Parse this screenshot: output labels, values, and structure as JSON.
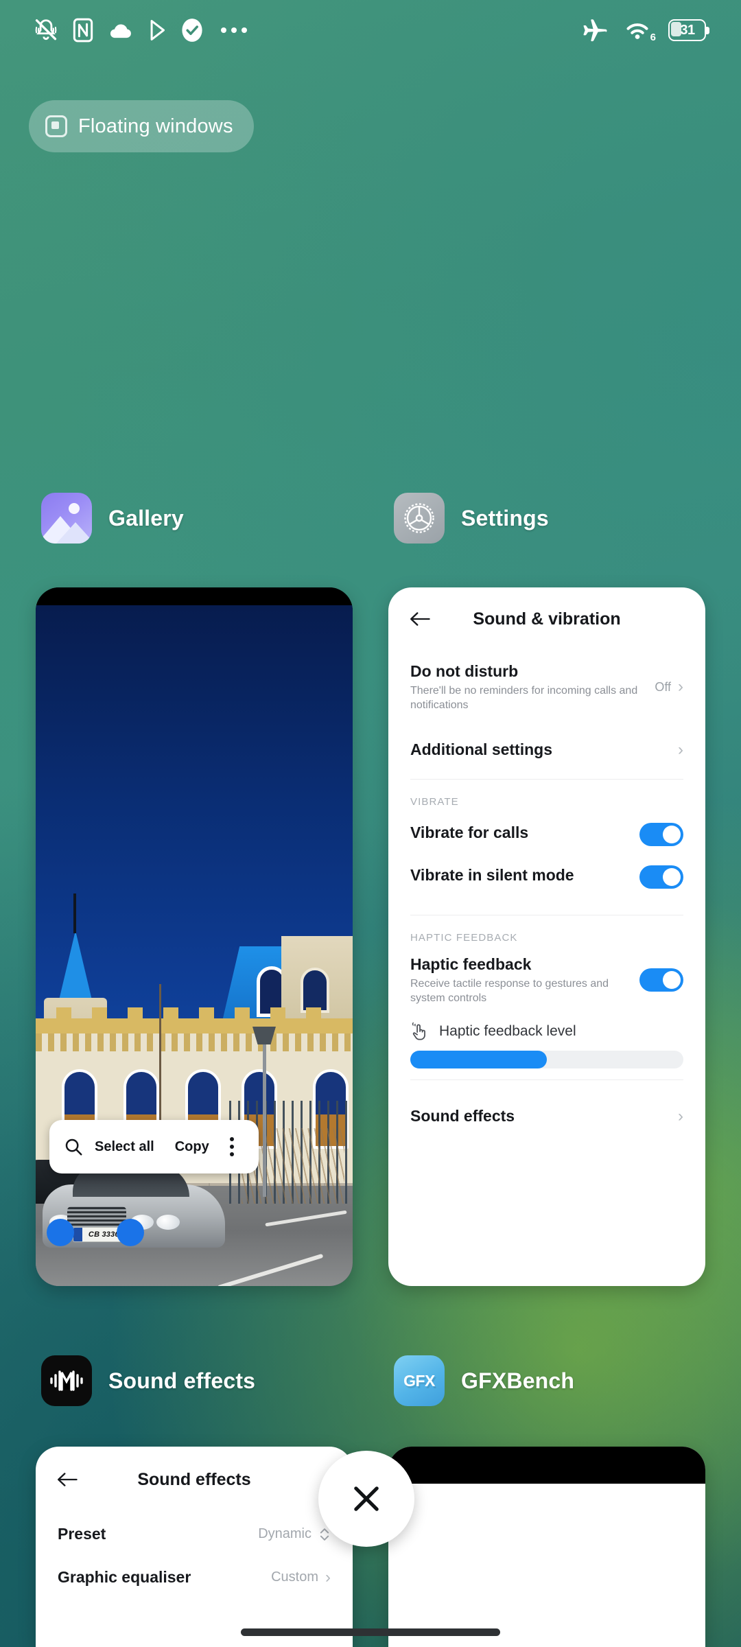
{
  "status_bar": {
    "left_icons": [
      "silent-bell-icon",
      "nfc-icon",
      "cloud-icon",
      "play-store-icon",
      "check-circle-icon",
      "more-icon"
    ],
    "right_icons": [
      "airplane-mode-icon",
      "wifi-6-icon"
    ],
    "wifi_generation": "6",
    "battery_percent": "31"
  },
  "floating_windows_pill": {
    "label": "Floating windows",
    "icon": "floating-window-icon"
  },
  "recents": [
    {
      "app_name": "Gallery",
      "icon": "gallery-icon",
      "selection_toolbar": {
        "search_icon": "search-icon",
        "select_all": "Select all",
        "copy": "Copy",
        "overflow_icon": "kebab-menu-icon"
      },
      "photo": {
        "license_plate": "CB 3336 HT"
      }
    },
    {
      "app_name": "Settings",
      "icon": "settings-gear-icon",
      "screen": {
        "back_icon": "back-arrow-icon",
        "title": "Sound & vibration",
        "rows": [
          {
            "title": "Do not disturb",
            "subtitle": "There'll be no reminders for incoming calls and notifications",
            "value": "Off",
            "chevron": "chevron-right-icon"
          },
          {
            "title": "Additional settings",
            "subtitle": "",
            "value": "",
            "chevron": "chevron-right-icon"
          }
        ],
        "vibrate_section": {
          "caption": "VIBRATE",
          "items": [
            {
              "label": "Vibrate for calls",
              "toggle": "on"
            },
            {
              "label": "Vibrate in silent mode",
              "toggle": "on"
            }
          ]
        },
        "haptic_section": {
          "caption": "HAPTIC FEEDBACK",
          "title": "Haptic feedback",
          "subtitle": "Receive tactile response to gestures and system controls",
          "toggle": "on",
          "level_label": "Haptic feedback level",
          "level_icon": "haptic-tap-icon",
          "level_percent": 50
        },
        "footer_row": {
          "label": "Sound effects",
          "chevron": "chevron-right-icon"
        }
      }
    },
    {
      "app_name": "Sound effects",
      "icon": "sound-effects-icon",
      "screen": {
        "back_icon": "back-arrow-icon",
        "title": "Sound effects",
        "rows": [
          {
            "label": "Preset",
            "value": "Dynamic",
            "control": "updown-chevron-icon"
          },
          {
            "label": "Graphic equaliser",
            "value": "Custom",
            "control": "chevron-right-icon"
          }
        ]
      }
    },
    {
      "app_name": "GFXBench",
      "icon": "gfx-icon",
      "icon_text": "GFX"
    }
  ],
  "close_all_button": {
    "icon": "close-x-icon"
  },
  "colors": {
    "accent_blue": "#1a8cf5",
    "selection_blue": "#1a73e8",
    "wallpaper_teal": "#3f9077",
    "wallpaper_green": "#96c83c",
    "card_white": "#ffffff"
  }
}
